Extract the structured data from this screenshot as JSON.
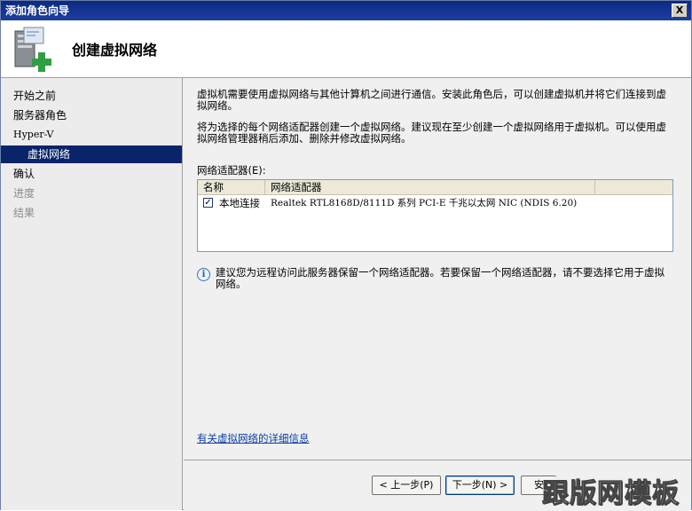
{
  "window": {
    "title": "添加角色向导",
    "close_glyph": "X"
  },
  "header": {
    "title": "创建虚拟网络",
    "icon": "server-add-icon"
  },
  "sidebar": {
    "items": [
      {
        "label": "开始之前",
        "state": "normal"
      },
      {
        "label": "服务器角色",
        "state": "normal"
      },
      {
        "label": "Hyper-V",
        "state": "normal"
      },
      {
        "label": "虚拟网络",
        "state": "active"
      },
      {
        "label": "确认",
        "state": "normal"
      },
      {
        "label": "进度",
        "state": "disabled"
      },
      {
        "label": "结果",
        "state": "disabled"
      }
    ]
  },
  "main": {
    "para1": "虚拟机需要使用虚拟网络与其他计算机之间进行通信。安装此角色后，可以创建虚拟机并将它们连接到虚拟网络。",
    "para2": "将为选择的每个网络适配器创建一个虚拟网络。建议现在至少创建一个虚拟网络用于虚拟机。可以使用虚拟网络管理器稍后添加、删除并修改虚拟网络。",
    "adapters_label": "网络适配器(E):",
    "table": {
      "columns": [
        "名称",
        "网络适配器"
      ],
      "rows": [
        {
          "checked": true,
          "name": "本地连接",
          "adapter": "Realtek RTL8168D/8111D 系列 PCI-E 千兆以太网 NIC (NDIS 6.20)"
        }
      ]
    },
    "info_icon": "info-icon",
    "info_text": "建议您为远程访问此服务器保留一个网络适配器。若要保留一个网络适配器，请不要选择它用于虚拟网络。",
    "more_link": "有关虚拟网络的详细信息"
  },
  "footer": {
    "prev_label": "< 上一步(P)",
    "next_label": "下一步(N) >",
    "third_label": "安"
  },
  "watermark": "跟版网模板",
  "colors": {
    "titlebar": "#0b2a82",
    "active_item": "#0a246a",
    "link": "#0b3ea8"
  }
}
